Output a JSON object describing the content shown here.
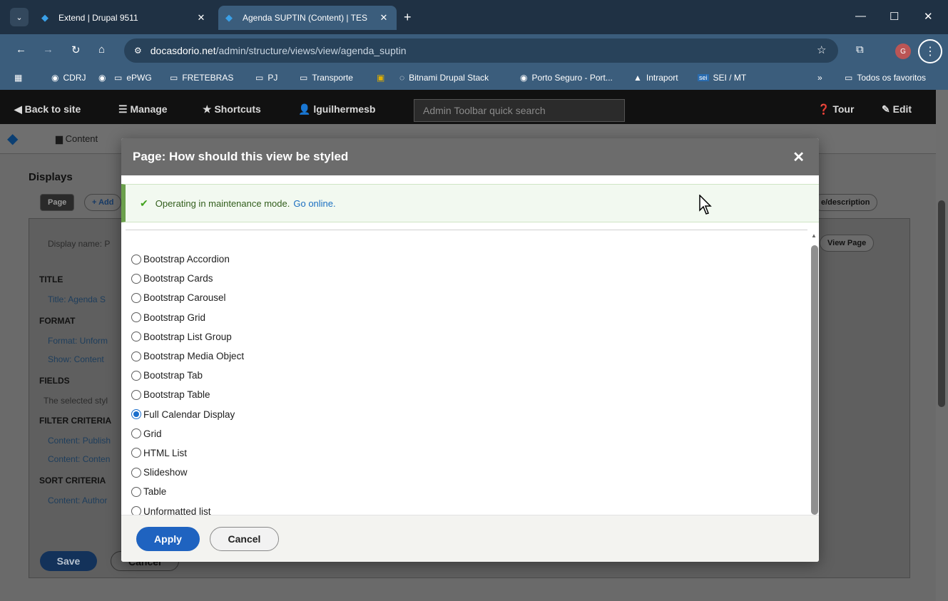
{
  "browser": {
    "tabs": [
      {
        "title": "Extend | Drupal 9511",
        "close": "✕"
      },
      {
        "title": "Agenda SUPTIN (Content) | TES",
        "close": "✕"
      }
    ],
    "new_tab": "+",
    "window_controls": {
      "minimize": "—",
      "maximize": "☐",
      "close": "✕"
    },
    "url_host": "docasdorio.net",
    "url_path": "/admin/structure/views/view/agenda_suptin",
    "profile_initial": "G",
    "bookmarks": [
      {
        "label": "",
        "icon": "apps-grid-icon"
      },
      {
        "label": "CDRJ",
        "icon": "globe-icon"
      },
      {
        "label": "",
        "icon": "globe-icon"
      },
      {
        "label": "ePWG",
        "icon": "folder-icon"
      },
      {
        "label": "FRETEBRAS",
        "icon": "folder-icon"
      },
      {
        "label": "PJ",
        "icon": "folder-icon"
      },
      {
        "label": "Transporte",
        "icon": "folder-icon"
      },
      {
        "label": "",
        "icon": "box-icon"
      },
      {
        "label": "Bitnami Drupal Stack",
        "icon": "bitnami-icon"
      },
      {
        "label": "Porto Seguro - Port...",
        "icon": "globe-icon"
      },
      {
        "label": "Intraport",
        "icon": "intraport-icon"
      },
      {
        "label": "SEI / MT",
        "icon": "sei-icon"
      }
    ],
    "bookmarks_overflow": "»",
    "all_bookmarks": "Todos os favoritos"
  },
  "admin_toolbar": {
    "back_to_site": "Back to site",
    "manage": "Manage",
    "shortcuts": "Shortcuts",
    "user": "lguilhermesb",
    "search_placeholder": "Admin Toolbar quick search",
    "tour": "Tour",
    "edit": "Edit"
  },
  "tray": {
    "content": "Content"
  },
  "background_page": {
    "displays_heading": "Displays",
    "page_tab": "Page",
    "add_button": "+ Add",
    "display_name_label": "Display name: P",
    "title_heading": "TITLE",
    "title_value": "Title: Agenda S",
    "format_heading": "FORMAT",
    "format_value": "Format: Unform",
    "show_value": "Show: Content",
    "fields_heading": "FIELDS",
    "fields_note": "The selected styl",
    "filter_heading": "FILTER CRITERIA",
    "filter_1": "Content: Publish",
    "filter_2": "Content: Conten",
    "sort_heading": "SORT CRITERIA",
    "sort_1": "Content: Author",
    "edit_desc_button": "e/description",
    "view_page_button": "View Page",
    "save": "Save",
    "cancel": "Cancel"
  },
  "modal": {
    "title": "Page: How should this view be styled",
    "close": "✕",
    "status_text": "Operating in maintenance mode.",
    "status_link": "Go online.",
    "options": [
      {
        "label": "Bootstrap Accordion",
        "checked": false
      },
      {
        "label": "Bootstrap Cards",
        "checked": false
      },
      {
        "label": "Bootstrap Carousel",
        "checked": false
      },
      {
        "label": "Bootstrap Grid",
        "checked": false
      },
      {
        "label": "Bootstrap List Group",
        "checked": false
      },
      {
        "label": "Bootstrap Media Object",
        "checked": false
      },
      {
        "label": "Bootstrap Tab",
        "checked": false
      },
      {
        "label": "Bootstrap Table",
        "checked": false
      },
      {
        "label": "Full Calendar Display",
        "checked": true
      },
      {
        "label": "Grid",
        "checked": false
      },
      {
        "label": "HTML List",
        "checked": false
      },
      {
        "label": "Slideshow",
        "checked": false
      },
      {
        "label": "Table",
        "checked": false
      },
      {
        "label": "Unformatted list",
        "checked": false
      }
    ],
    "apply": "Apply",
    "cancel": "Cancel"
  },
  "colors": {
    "accent": "#1f63c0",
    "status_green": "#6ba04c",
    "browser_frame": "#3b5d7c"
  }
}
